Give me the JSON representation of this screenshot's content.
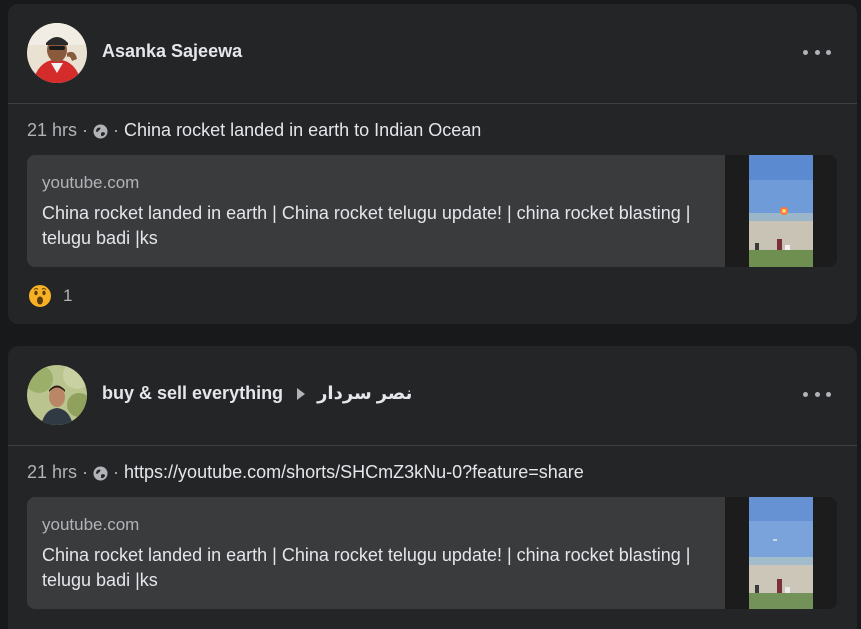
{
  "posts": [
    {
      "author": "Asanka Sajeewa",
      "time": "21 hrs",
      "separator": "·",
      "caption": "China rocket landed in earth to Indian Ocean",
      "link": {
        "domain": "youtube.com",
        "title": "China rocket landed in earth | China rocket telugu update! | china rocket blasting | telugu badi |ks"
      },
      "reaction_icon": "wow-emoji-icon",
      "reaction_count": "1"
    },
    {
      "author": "buy & sell everything",
      "recipient": "نصر سردار",
      "time": "21 hrs",
      "separator": "·",
      "caption": "https://youtube.com/shorts/SHCmZ3kNu-0?feature=share",
      "link": {
        "domain": "youtube.com",
        "title": "China rocket landed in earth | China rocket telugu update! | china rocket blasting | telugu badi |ks"
      }
    }
  ],
  "colors": {
    "background": "#18191a",
    "card": "#242526",
    "link_card": "#3a3b3c",
    "primary_text": "#e4e6eb",
    "secondary_text": "#b0b3b8",
    "divider": "#3e4042"
  }
}
